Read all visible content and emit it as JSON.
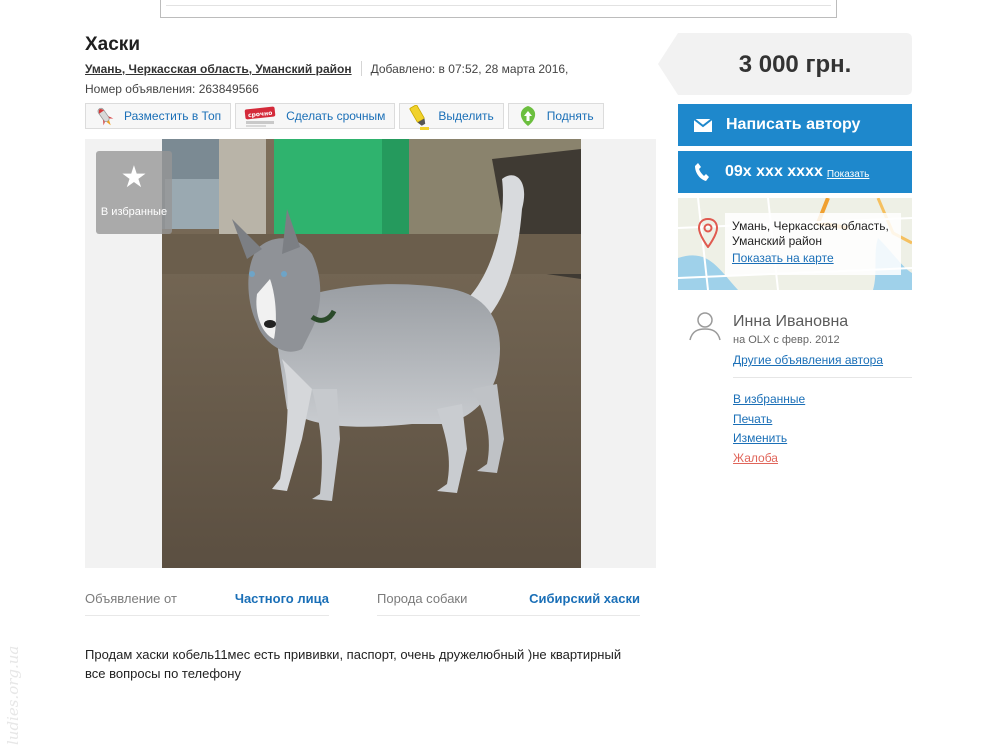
{
  "listing": {
    "title": "Хаски",
    "location": "Умань, Черкасская область, Уманский район",
    "added": "Добавлено: в 07:52, 28 марта 2016,",
    "ad_number": "Номер объявления: 263849566"
  },
  "actions": [
    {
      "label": "Разместить в Топ",
      "icon": "rocket-icon"
    },
    {
      "label": "Сделать срочным",
      "icon": "urgent-tag-icon",
      "badge": "срочно"
    },
    {
      "label": "Выделить",
      "icon": "highlighter-icon"
    },
    {
      "label": "Поднять",
      "icon": "leaf-arrow-icon"
    }
  ],
  "gallery": {
    "favorite_label": "В избранные",
    "photo": "husky-photo"
  },
  "params": [
    {
      "key": "Объявление от",
      "value": "Частного лица"
    },
    {
      "key": "Порода собаки",
      "value": "Сибирский хаски"
    }
  ],
  "description": {
    "line1": "Продам хаски кобель11мес есть прививки, паспорт, очень дружелюбный )не квартирный",
    "line2": "все вопросы по телефону"
  },
  "sidebar": {
    "price": "3 000 грн.",
    "message_button": "Написать автору",
    "phone": "09x xxx xxxx",
    "phone_show": "Показать",
    "map_address": "Умань, Черкасская область, Уманский район",
    "map_link": "Показать на карте",
    "user_name": "Инна Ивановна",
    "user_since": "на OLX с февр. 2012",
    "user_other": "Другие объявления автора",
    "links": [
      "В избранные",
      "Печать",
      "Изменить",
      "Жалоба"
    ]
  },
  "colors": {
    "accent_blue": "#1e88cc",
    "link_blue": "#1a6fb7",
    "complaint_red": "#e0655a"
  },
  "watermark": "ludies.org.ua"
}
